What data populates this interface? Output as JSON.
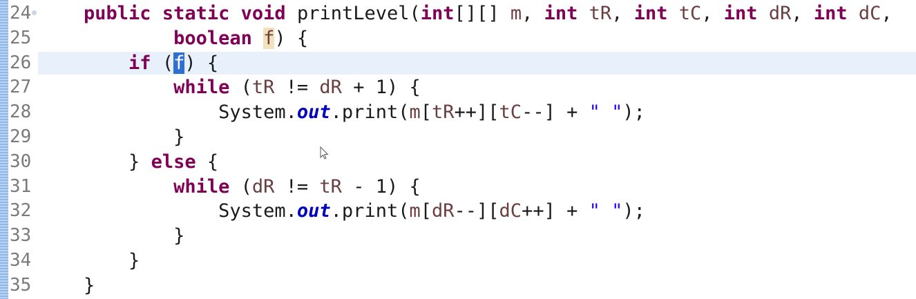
{
  "editor": {
    "language": "Java",
    "selected_word": "f",
    "current_line_number": "26",
    "lines": [
      {
        "num": "24",
        "indent": "    ",
        "tokens": [
          {
            "t": "public",
            "k": "kw"
          },
          {
            "t": " ",
            "k": ""
          },
          {
            "t": "static",
            "k": "kw"
          },
          {
            "t": " ",
            "k": ""
          },
          {
            "t": "void",
            "k": "kw"
          },
          {
            "t": " printLevel(",
            "k": ""
          },
          {
            "t": "int",
            "k": "kw"
          },
          {
            "t": "[][] ",
            "k": ""
          },
          {
            "t": "m",
            "k": "var"
          },
          {
            "t": ", ",
            "k": ""
          },
          {
            "t": "int",
            "k": "kw"
          },
          {
            "t": " ",
            "k": ""
          },
          {
            "t": "tR",
            "k": "var"
          },
          {
            "t": ", ",
            "k": ""
          },
          {
            "t": "int",
            "k": "kw"
          },
          {
            "t": " ",
            "k": ""
          },
          {
            "t": "tC",
            "k": "var"
          },
          {
            "t": ", ",
            "k": ""
          },
          {
            "t": "int",
            "k": "kw"
          },
          {
            "t": " ",
            "k": ""
          },
          {
            "t": "dR",
            "k": "var"
          },
          {
            "t": ", ",
            "k": ""
          },
          {
            "t": "int",
            "k": "kw"
          },
          {
            "t": " ",
            "k": ""
          },
          {
            "t": "dC",
            "k": "var"
          },
          {
            "t": ",",
            "k": ""
          }
        ]
      },
      {
        "num": "25",
        "indent": "            ",
        "tokens": [
          {
            "t": "boolean",
            "k": "kw"
          },
          {
            "t": " ",
            "k": ""
          },
          {
            "t": "f",
            "k": "var occ"
          },
          {
            "t": ") {",
            "k": ""
          }
        ]
      },
      {
        "num": "26",
        "indent": "        ",
        "tokens": [
          {
            "t": "if",
            "k": "kw"
          },
          {
            "t": " (",
            "k": ""
          },
          {
            "t": "f",
            "k": "sel"
          },
          {
            "t": ") {",
            "k": ""
          }
        ]
      },
      {
        "num": "27",
        "indent": "            ",
        "tokens": [
          {
            "t": "while",
            "k": "kw"
          },
          {
            "t": " (",
            "k": ""
          },
          {
            "t": "tR",
            "k": "var"
          },
          {
            "t": " != ",
            "k": ""
          },
          {
            "t": "dR",
            "k": "var"
          },
          {
            "t": " + 1) {",
            "k": ""
          }
        ]
      },
      {
        "num": "28",
        "indent": "                ",
        "tokens": [
          {
            "t": "System.",
            "k": ""
          },
          {
            "t": "out",
            "k": "fld"
          },
          {
            "t": ".print(",
            "k": ""
          },
          {
            "t": "m",
            "k": "var"
          },
          {
            "t": "[",
            "k": ""
          },
          {
            "t": "tR",
            "k": "var"
          },
          {
            "t": "++][",
            "k": ""
          },
          {
            "t": "tC",
            "k": "var"
          },
          {
            "t": "--] + ",
            "k": ""
          },
          {
            "t": "\" \"",
            "k": "str"
          },
          {
            "t": ");",
            "k": ""
          }
        ]
      },
      {
        "num": "29",
        "indent": "            ",
        "tokens": [
          {
            "t": "}",
            "k": ""
          }
        ]
      },
      {
        "num": "30",
        "indent": "        ",
        "tokens": [
          {
            "t": "} ",
            "k": ""
          },
          {
            "t": "else",
            "k": "kw"
          },
          {
            "t": " {",
            "k": ""
          }
        ]
      },
      {
        "num": "31",
        "indent": "            ",
        "tokens": [
          {
            "t": "while",
            "k": "kw"
          },
          {
            "t": " (",
            "k": ""
          },
          {
            "t": "dR",
            "k": "var"
          },
          {
            "t": " != ",
            "k": ""
          },
          {
            "t": "tR",
            "k": "var"
          },
          {
            "t": " - 1) {",
            "k": ""
          }
        ]
      },
      {
        "num": "32",
        "indent": "                ",
        "tokens": [
          {
            "t": "System.",
            "k": ""
          },
          {
            "t": "out",
            "k": "fld"
          },
          {
            "t": ".print(",
            "k": ""
          },
          {
            "t": "m",
            "k": "var"
          },
          {
            "t": "[",
            "k": ""
          },
          {
            "t": "dR",
            "k": "var"
          },
          {
            "t": "--][",
            "k": ""
          },
          {
            "t": "dC",
            "k": "var"
          },
          {
            "t": "++] + ",
            "k": ""
          },
          {
            "t": "\" \"",
            "k": "str"
          },
          {
            "t": ");",
            "k": ""
          }
        ]
      },
      {
        "num": "33",
        "indent": "            ",
        "tokens": [
          {
            "t": "}",
            "k": ""
          }
        ]
      },
      {
        "num": "34",
        "indent": "        ",
        "tokens": [
          {
            "t": "}",
            "k": ""
          }
        ]
      },
      {
        "num": "35",
        "indent": "    ",
        "tokens": [
          {
            "t": "}",
            "k": ""
          }
        ]
      }
    ]
  },
  "colors": {
    "keyword": "#7f0055",
    "variable": "#6a3e3e",
    "static_field": "#0000c0",
    "string": "#2a00ff",
    "current_line_bg": "#e8f0fc",
    "occurrence_bg": "#f2e1bd",
    "selection_bg": "#2f6fd0",
    "line_number": "#7a7a7a"
  }
}
